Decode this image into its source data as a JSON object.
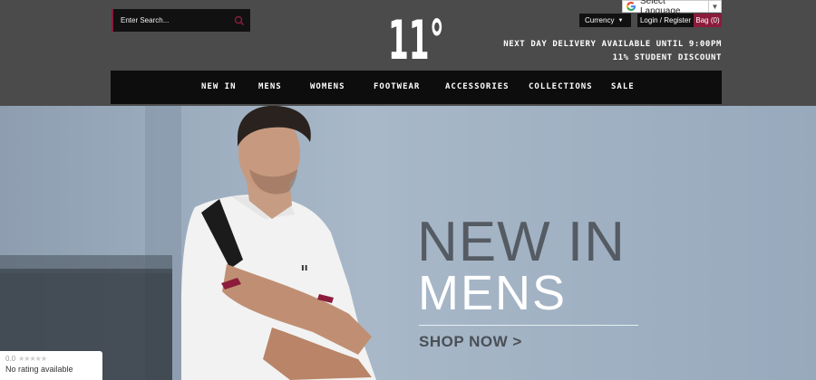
{
  "header": {
    "search_placeholder": "Enter Search...",
    "logo_text": "11°",
    "translate": {
      "label": "Select Language",
      "arrow": "▼"
    },
    "currency_label": "Currency",
    "currency_caret": "▼",
    "login_label": "Login / Register",
    "bag_label": "Bag (0)",
    "promo_line_1": "NEXT DAY DELIVERY AVAILABLE UNTIL 9:00PM",
    "promo_line_2": "11% STUDENT DISCOUNT"
  },
  "nav": {
    "items": [
      "NEW IN",
      "MENS",
      "WOMENS",
      "FOOTWEAR",
      "ACCESSORIES",
      "COLLECTIONS",
      "SALE"
    ]
  },
  "hero": {
    "headline_1": "NEW IN",
    "headline_2": "MENS",
    "cta": "SHOP NOW >"
  },
  "rating_widget": {
    "score": "0.0",
    "stars": "★★★★★",
    "text": "No rating available"
  },
  "colors": {
    "header_bg": "#4b4b4b",
    "nav_bg": "#0d0d0d",
    "accent": "#8b1c3c"
  }
}
